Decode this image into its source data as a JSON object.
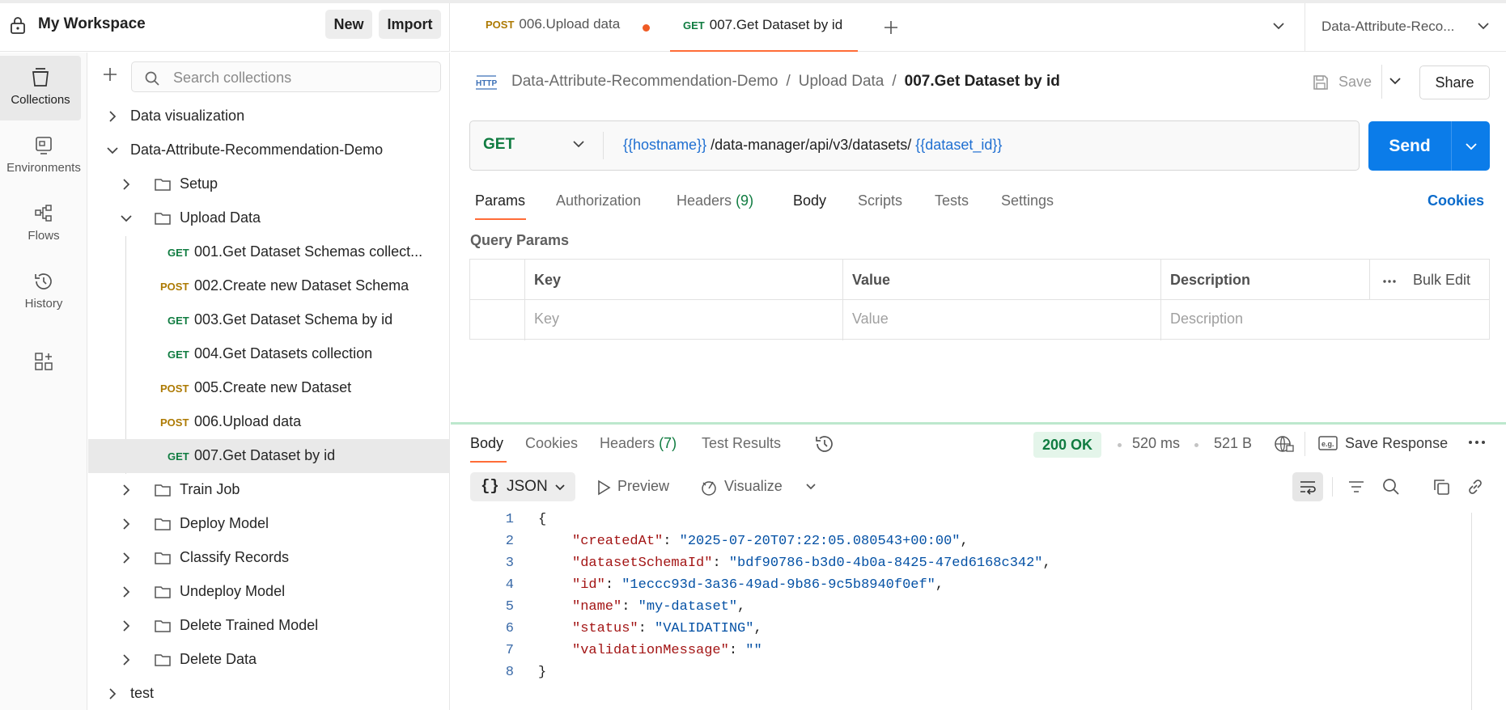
{
  "workspace": {
    "title": "My Workspace",
    "new_label": "New",
    "import_label": "Import"
  },
  "rail": [
    {
      "label": "Collections",
      "icon": "collections-icon"
    },
    {
      "label": "Environments",
      "icon": "environments-icon"
    },
    {
      "label": "Flows",
      "icon": "flows-icon"
    },
    {
      "label": "History",
      "icon": "history-icon"
    }
  ],
  "sidebar": {
    "search_placeholder": "Search collections",
    "tree": [
      {
        "label": "Data visualization",
        "kind": "collection",
        "expanded": false
      },
      {
        "label": "Data-Attribute-Recommendation-Demo",
        "kind": "collection",
        "expanded": true
      },
      {
        "label": "Setup",
        "kind": "folder",
        "expanded": false
      },
      {
        "label": "Upload Data",
        "kind": "folder",
        "expanded": true
      },
      {
        "label": "001.Get Dataset Schemas collect...",
        "kind": "request",
        "method": "GET"
      },
      {
        "label": "002.Create new Dataset Schema",
        "kind": "request",
        "method": "POST"
      },
      {
        "label": "003.Get Dataset Schema by id",
        "kind": "request",
        "method": "GET"
      },
      {
        "label": "004.Get Datasets collection",
        "kind": "request",
        "method": "GET"
      },
      {
        "label": "005.Create new Dataset",
        "kind": "request",
        "method": "POST"
      },
      {
        "label": "006.Upload data",
        "kind": "request",
        "method": "POST"
      },
      {
        "label": "007.Get Dataset by id",
        "kind": "request",
        "method": "GET",
        "selected": true
      },
      {
        "label": "Train Job",
        "kind": "folder",
        "expanded": false
      },
      {
        "label": "Deploy Model",
        "kind": "folder",
        "expanded": false
      },
      {
        "label": "Classify Records",
        "kind": "folder",
        "expanded": false
      },
      {
        "label": "Undeploy Model",
        "kind": "folder",
        "expanded": false
      },
      {
        "label": "Delete Trained Model",
        "kind": "folder",
        "expanded": false
      },
      {
        "label": "Delete Data",
        "kind": "folder",
        "expanded": false
      },
      {
        "label": "test",
        "kind": "collection",
        "expanded": false
      }
    ]
  },
  "tabs": [
    {
      "method": "POST",
      "label": "006.Upload data",
      "unsaved": true
    },
    {
      "method": "GET",
      "label": "007.Get Dataset by id",
      "active": true
    }
  ],
  "environment": {
    "selected": "Data-Attribute-Reco..."
  },
  "request": {
    "breadcrumb": [
      "Data-Attribute-Recommendation-Demo",
      "Upload Data"
    ],
    "name": "007.Get Dataset by id",
    "save_label": "Save",
    "share_label": "Share",
    "method": "GET",
    "url_var1": "{{hostname}}",
    "url_path": " /data-manager/api/v3/datasets/ ",
    "url_var2": "{{dataset_id}}",
    "send_label": "Send",
    "tabs": {
      "params": "Params",
      "authorization": "Authorization",
      "headers": "Headers",
      "headers_count": "(9)",
      "body": "Body",
      "scripts": "Scripts",
      "tests": "Tests",
      "settings": "Settings"
    },
    "cookies_link": "Cookies",
    "query_params": {
      "title": "Query Params",
      "columns": [
        "Key",
        "Value",
        "Description"
      ],
      "placeholders": [
        "Key",
        "Value",
        "Description"
      ],
      "bulk_edit": "Bulk Edit"
    }
  },
  "response": {
    "tabs": {
      "body": "Body",
      "cookies": "Cookies",
      "headers": "Headers",
      "headers_count": "(7)",
      "test_results": "Test Results"
    },
    "status": "200 OK",
    "time": "520 ms",
    "size": "521 B",
    "save_response": "Save Response",
    "format": "JSON",
    "preview": "Preview",
    "visualize": "Visualize",
    "lines": [
      {
        "n": "1",
        "text": "{"
      },
      {
        "n": "2",
        "key": "\"createdAt\"",
        "value": "\"2025-07-20T07:22:05.080543+00:00\"",
        "comma": true
      },
      {
        "n": "3",
        "key": "\"datasetSchemaId\"",
        "value": "\"bdf90786-b3d0-4b0a-8425-47ed6168c342\"",
        "comma": true
      },
      {
        "n": "4",
        "key": "\"id\"",
        "value": "\"1eccc93d-3a36-49ad-9b86-9c5b8940f0ef\"",
        "comma": true
      },
      {
        "n": "5",
        "key": "\"name\"",
        "value": "\"my-dataset\"",
        "comma": true
      },
      {
        "n": "6",
        "key": "\"status\"",
        "value": "\"VALIDATING\"",
        "comma": true
      },
      {
        "n": "7",
        "key": "\"validationMessage\"",
        "value": "\"\"",
        "comma": false
      },
      {
        "n": "8",
        "text": "}"
      }
    ]
  },
  "colors": {
    "accent": "#ff6c37",
    "send": "#0b7ce9",
    "get": "#107c41",
    "post": "#ad7a03",
    "status_ok_bg": "#e4f5ea"
  }
}
